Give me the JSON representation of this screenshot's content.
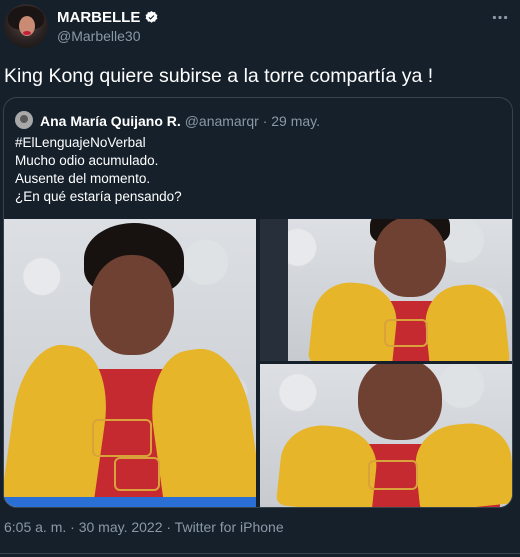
{
  "tweet": {
    "display_name": "MARBELLE",
    "handle": "@Marbelle30",
    "text": "King Kong quiere subirse a la torre compartía ya !",
    "footer": "6:05 a. m. · 30 may. 2022 · Twitter for iPhone"
  },
  "quoted": {
    "name": "Ana María Quijano R.",
    "meta": " @anamarqr · 29 may.",
    "lines": [
      "#ElLenguajeNoVerbal",
      "Mucho odio acumulado.",
      "Ausente del momento.",
      "¿En qué estaría pensando?"
    ]
  },
  "icons": {
    "verified": "verified-badge-icon",
    "more": "more-options-icon"
  },
  "colors": {
    "background": "#15202b",
    "secondary_text": "#8b98a5",
    "border": "#38444d",
    "scarf": "#e6b52a",
    "dress": "#c42a2f"
  }
}
